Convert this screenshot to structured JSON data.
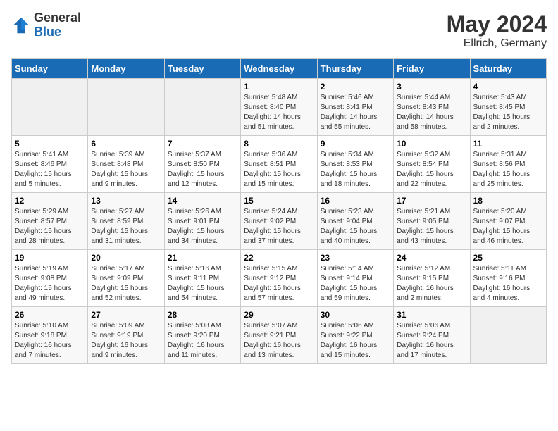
{
  "header": {
    "logo_line1": "General",
    "logo_line2": "Blue",
    "title": "May 2024",
    "subtitle": "Ellrich, Germany"
  },
  "calendar": {
    "headers": [
      "Sunday",
      "Monday",
      "Tuesday",
      "Wednesday",
      "Thursday",
      "Friday",
      "Saturday"
    ],
    "weeks": [
      [
        {
          "day": "",
          "info": ""
        },
        {
          "day": "",
          "info": ""
        },
        {
          "day": "",
          "info": ""
        },
        {
          "day": "1",
          "info": "Sunrise: 5:48 AM\nSunset: 8:40 PM\nDaylight: 14 hours\nand 51 minutes."
        },
        {
          "day": "2",
          "info": "Sunrise: 5:46 AM\nSunset: 8:41 PM\nDaylight: 14 hours\nand 55 minutes."
        },
        {
          "day": "3",
          "info": "Sunrise: 5:44 AM\nSunset: 8:43 PM\nDaylight: 14 hours\nand 58 minutes."
        },
        {
          "day": "4",
          "info": "Sunrise: 5:43 AM\nSunset: 8:45 PM\nDaylight: 15 hours\nand 2 minutes."
        }
      ],
      [
        {
          "day": "5",
          "info": "Sunrise: 5:41 AM\nSunset: 8:46 PM\nDaylight: 15 hours\nand 5 minutes."
        },
        {
          "day": "6",
          "info": "Sunrise: 5:39 AM\nSunset: 8:48 PM\nDaylight: 15 hours\nand 9 minutes."
        },
        {
          "day": "7",
          "info": "Sunrise: 5:37 AM\nSunset: 8:50 PM\nDaylight: 15 hours\nand 12 minutes."
        },
        {
          "day": "8",
          "info": "Sunrise: 5:36 AM\nSunset: 8:51 PM\nDaylight: 15 hours\nand 15 minutes."
        },
        {
          "day": "9",
          "info": "Sunrise: 5:34 AM\nSunset: 8:53 PM\nDaylight: 15 hours\nand 18 minutes."
        },
        {
          "day": "10",
          "info": "Sunrise: 5:32 AM\nSunset: 8:54 PM\nDaylight: 15 hours\nand 22 minutes."
        },
        {
          "day": "11",
          "info": "Sunrise: 5:31 AM\nSunset: 8:56 PM\nDaylight: 15 hours\nand 25 minutes."
        }
      ],
      [
        {
          "day": "12",
          "info": "Sunrise: 5:29 AM\nSunset: 8:57 PM\nDaylight: 15 hours\nand 28 minutes."
        },
        {
          "day": "13",
          "info": "Sunrise: 5:27 AM\nSunset: 8:59 PM\nDaylight: 15 hours\nand 31 minutes."
        },
        {
          "day": "14",
          "info": "Sunrise: 5:26 AM\nSunset: 9:01 PM\nDaylight: 15 hours\nand 34 minutes."
        },
        {
          "day": "15",
          "info": "Sunrise: 5:24 AM\nSunset: 9:02 PM\nDaylight: 15 hours\nand 37 minutes."
        },
        {
          "day": "16",
          "info": "Sunrise: 5:23 AM\nSunset: 9:04 PM\nDaylight: 15 hours\nand 40 minutes."
        },
        {
          "day": "17",
          "info": "Sunrise: 5:21 AM\nSunset: 9:05 PM\nDaylight: 15 hours\nand 43 minutes."
        },
        {
          "day": "18",
          "info": "Sunrise: 5:20 AM\nSunset: 9:07 PM\nDaylight: 15 hours\nand 46 minutes."
        }
      ],
      [
        {
          "day": "19",
          "info": "Sunrise: 5:19 AM\nSunset: 9:08 PM\nDaylight: 15 hours\nand 49 minutes."
        },
        {
          "day": "20",
          "info": "Sunrise: 5:17 AM\nSunset: 9:09 PM\nDaylight: 15 hours\nand 52 minutes."
        },
        {
          "day": "21",
          "info": "Sunrise: 5:16 AM\nSunset: 9:11 PM\nDaylight: 15 hours\nand 54 minutes."
        },
        {
          "day": "22",
          "info": "Sunrise: 5:15 AM\nSunset: 9:12 PM\nDaylight: 15 hours\nand 57 minutes."
        },
        {
          "day": "23",
          "info": "Sunrise: 5:14 AM\nSunset: 9:14 PM\nDaylight: 15 hours\nand 59 minutes."
        },
        {
          "day": "24",
          "info": "Sunrise: 5:12 AM\nSunset: 9:15 PM\nDaylight: 16 hours\nand 2 minutes."
        },
        {
          "day": "25",
          "info": "Sunrise: 5:11 AM\nSunset: 9:16 PM\nDaylight: 16 hours\nand 4 minutes."
        }
      ],
      [
        {
          "day": "26",
          "info": "Sunrise: 5:10 AM\nSunset: 9:18 PM\nDaylight: 16 hours\nand 7 minutes."
        },
        {
          "day": "27",
          "info": "Sunrise: 5:09 AM\nSunset: 9:19 PM\nDaylight: 16 hours\nand 9 minutes."
        },
        {
          "day": "28",
          "info": "Sunrise: 5:08 AM\nSunset: 9:20 PM\nDaylight: 16 hours\nand 11 minutes."
        },
        {
          "day": "29",
          "info": "Sunrise: 5:07 AM\nSunset: 9:21 PM\nDaylight: 16 hours\nand 13 minutes."
        },
        {
          "day": "30",
          "info": "Sunrise: 5:06 AM\nSunset: 9:22 PM\nDaylight: 16 hours\nand 15 minutes."
        },
        {
          "day": "31",
          "info": "Sunrise: 5:06 AM\nSunset: 9:24 PM\nDaylight: 16 hours\nand 17 minutes."
        },
        {
          "day": "",
          "info": ""
        }
      ]
    ]
  }
}
